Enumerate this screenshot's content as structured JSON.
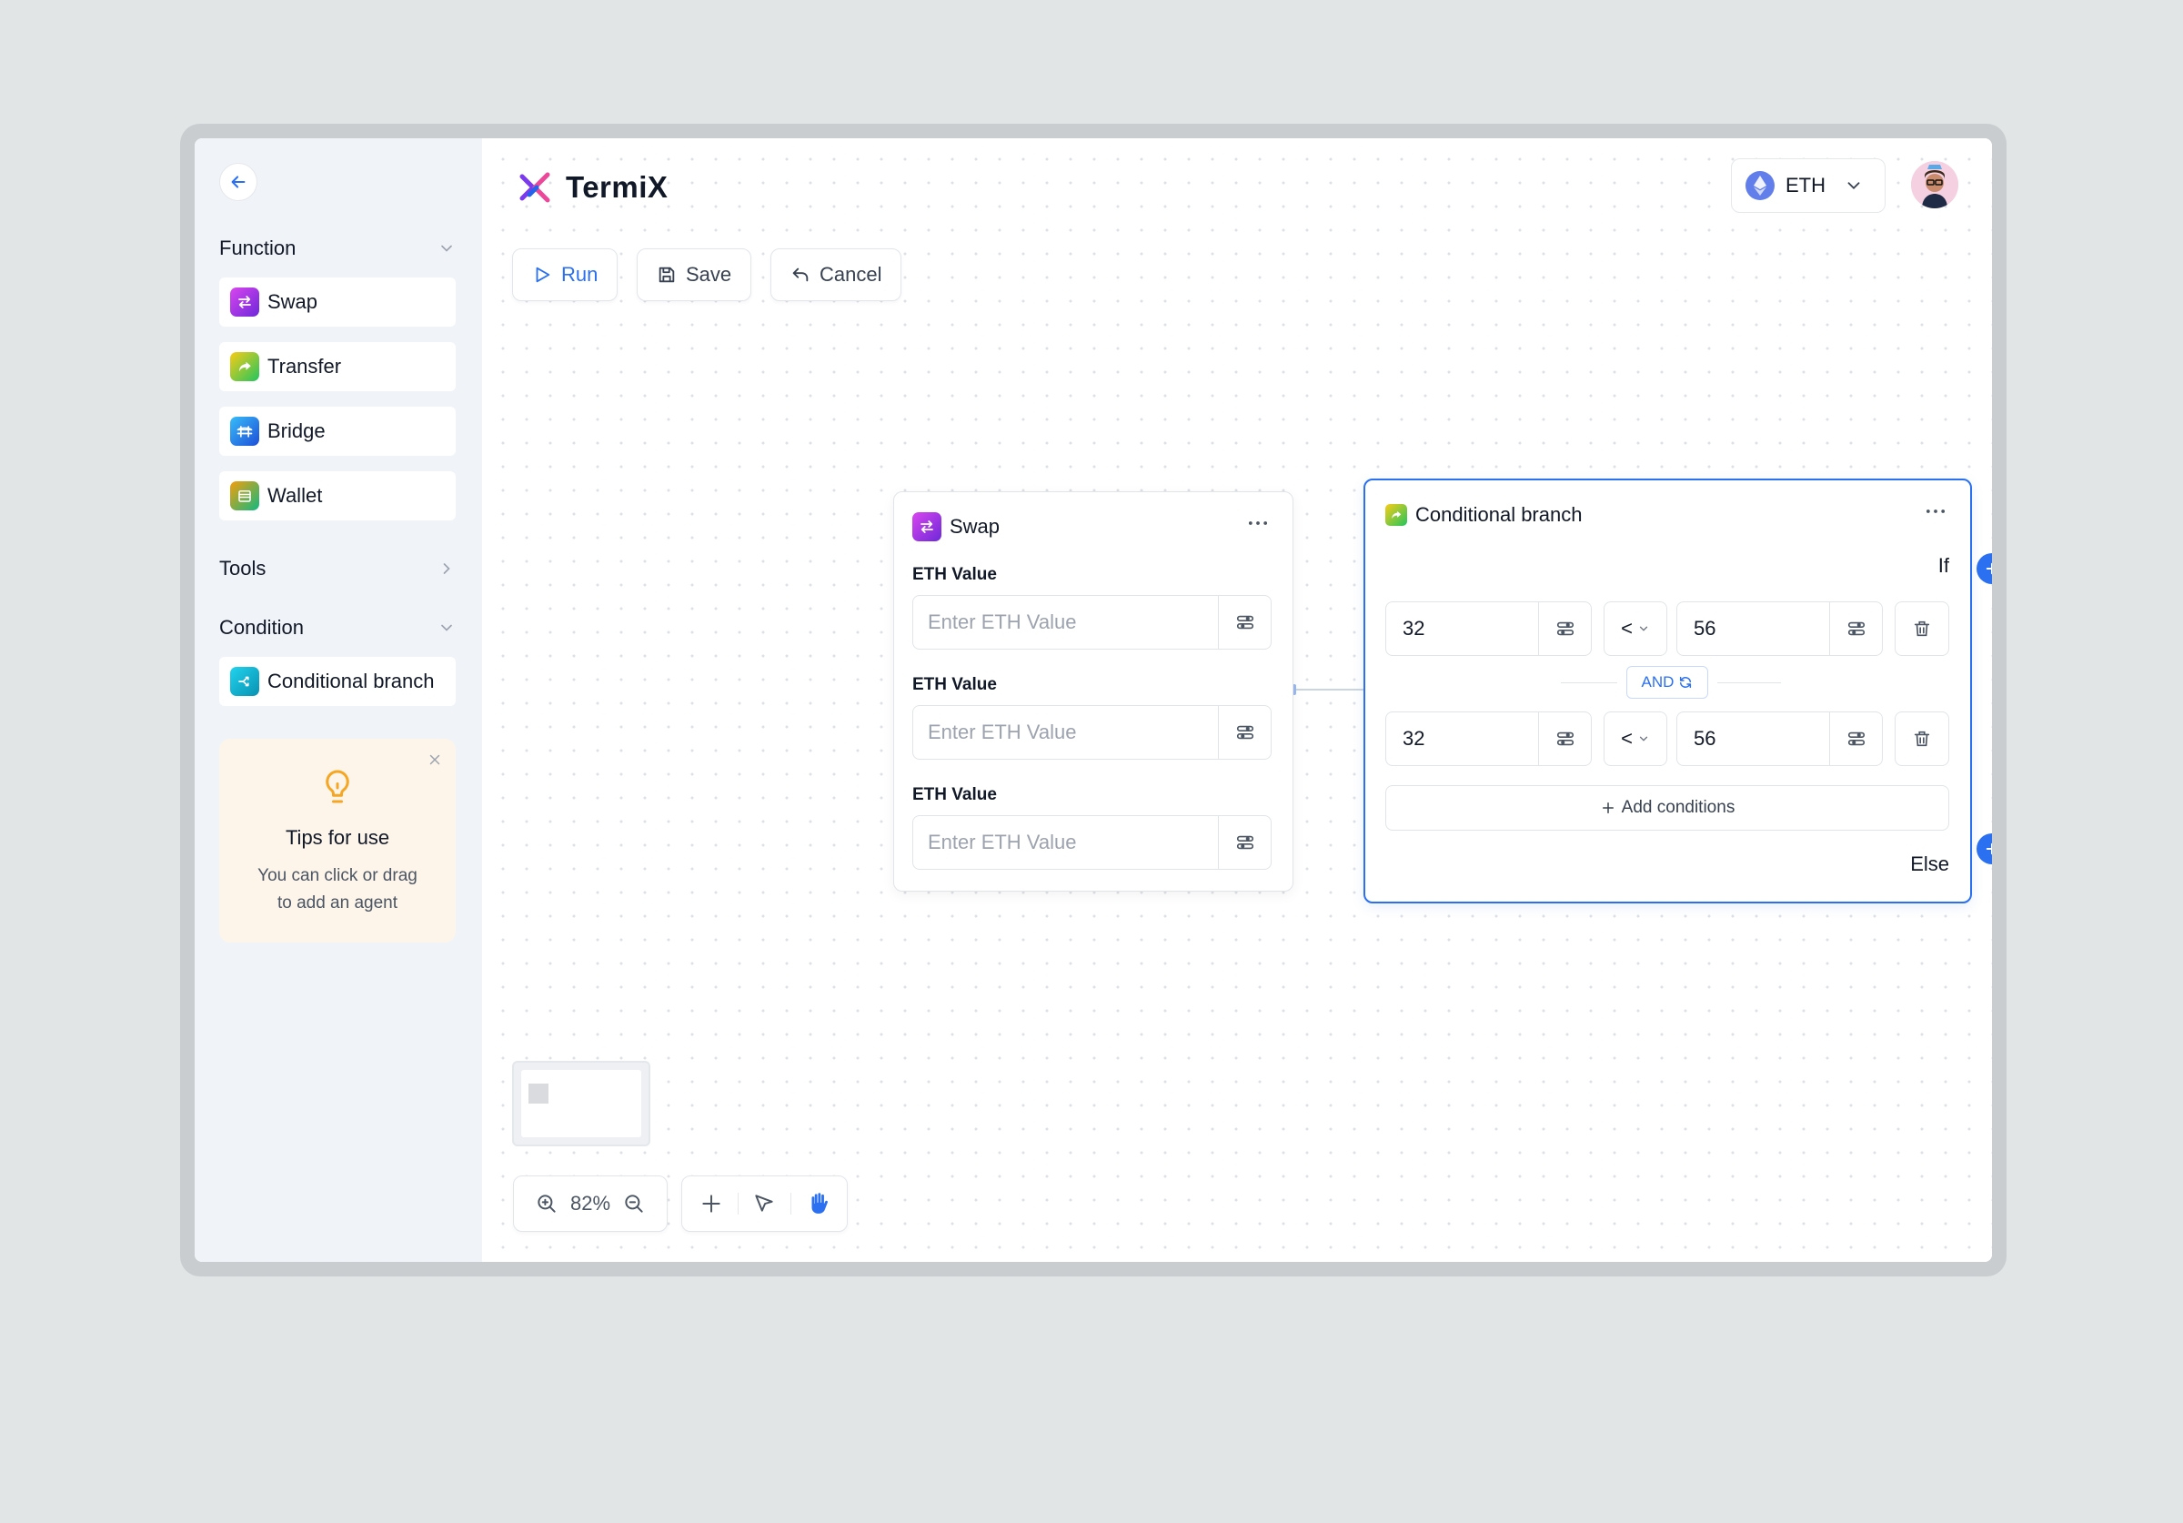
{
  "app": {
    "name": "TermiX"
  },
  "header": {
    "chain_label": "ETH"
  },
  "toolbar": {
    "run_label": "Run",
    "save_label": "Save",
    "cancel_label": "Cancel"
  },
  "sidebar": {
    "function_title": "Function",
    "function_items": [
      {
        "label": "Swap",
        "icon": "swap-icon",
        "color": "#8b3df5"
      },
      {
        "label": "Transfer",
        "icon": "transfer-icon",
        "color": "#34c46a"
      },
      {
        "label": "Bridge",
        "icon": "bridge-icon",
        "color": "#2a7bf0"
      },
      {
        "label": "Wallet",
        "icon": "wallet-icon",
        "color": "#e8a34a"
      }
    ],
    "tools_title": "Tools",
    "condition_title": "Condition",
    "condition_items": [
      {
        "label": "Conditional branch",
        "icon": "branch-icon",
        "color": "#18b4e0"
      }
    ],
    "tips": {
      "title": "Tips for use",
      "line1": "You can click or drag",
      "line2": "to add an agent"
    }
  },
  "swap_node": {
    "title": "Swap",
    "fields": [
      {
        "label": "ETH Value",
        "placeholder": "Enter ETH Value"
      },
      {
        "label": "ETH Value",
        "placeholder": "Enter ETH Value"
      },
      {
        "label": "ETH Value",
        "placeholder": "Enter ETH Value"
      }
    ]
  },
  "cond_node": {
    "title": "Conditional branch",
    "if_label": "If",
    "else_label": "Else",
    "conditions": [
      {
        "left": "32",
        "operator": "<",
        "right": "56"
      },
      {
        "left": "32",
        "operator": "<",
        "right": "56"
      }
    ],
    "logic": "AND",
    "add_label": "Add conditions"
  },
  "zoom": {
    "value": "82%"
  },
  "colors": {
    "accent": "#2b70f0",
    "sidebar_bg": "#f0f3f8",
    "tips_bg": "#fdf5ea"
  }
}
